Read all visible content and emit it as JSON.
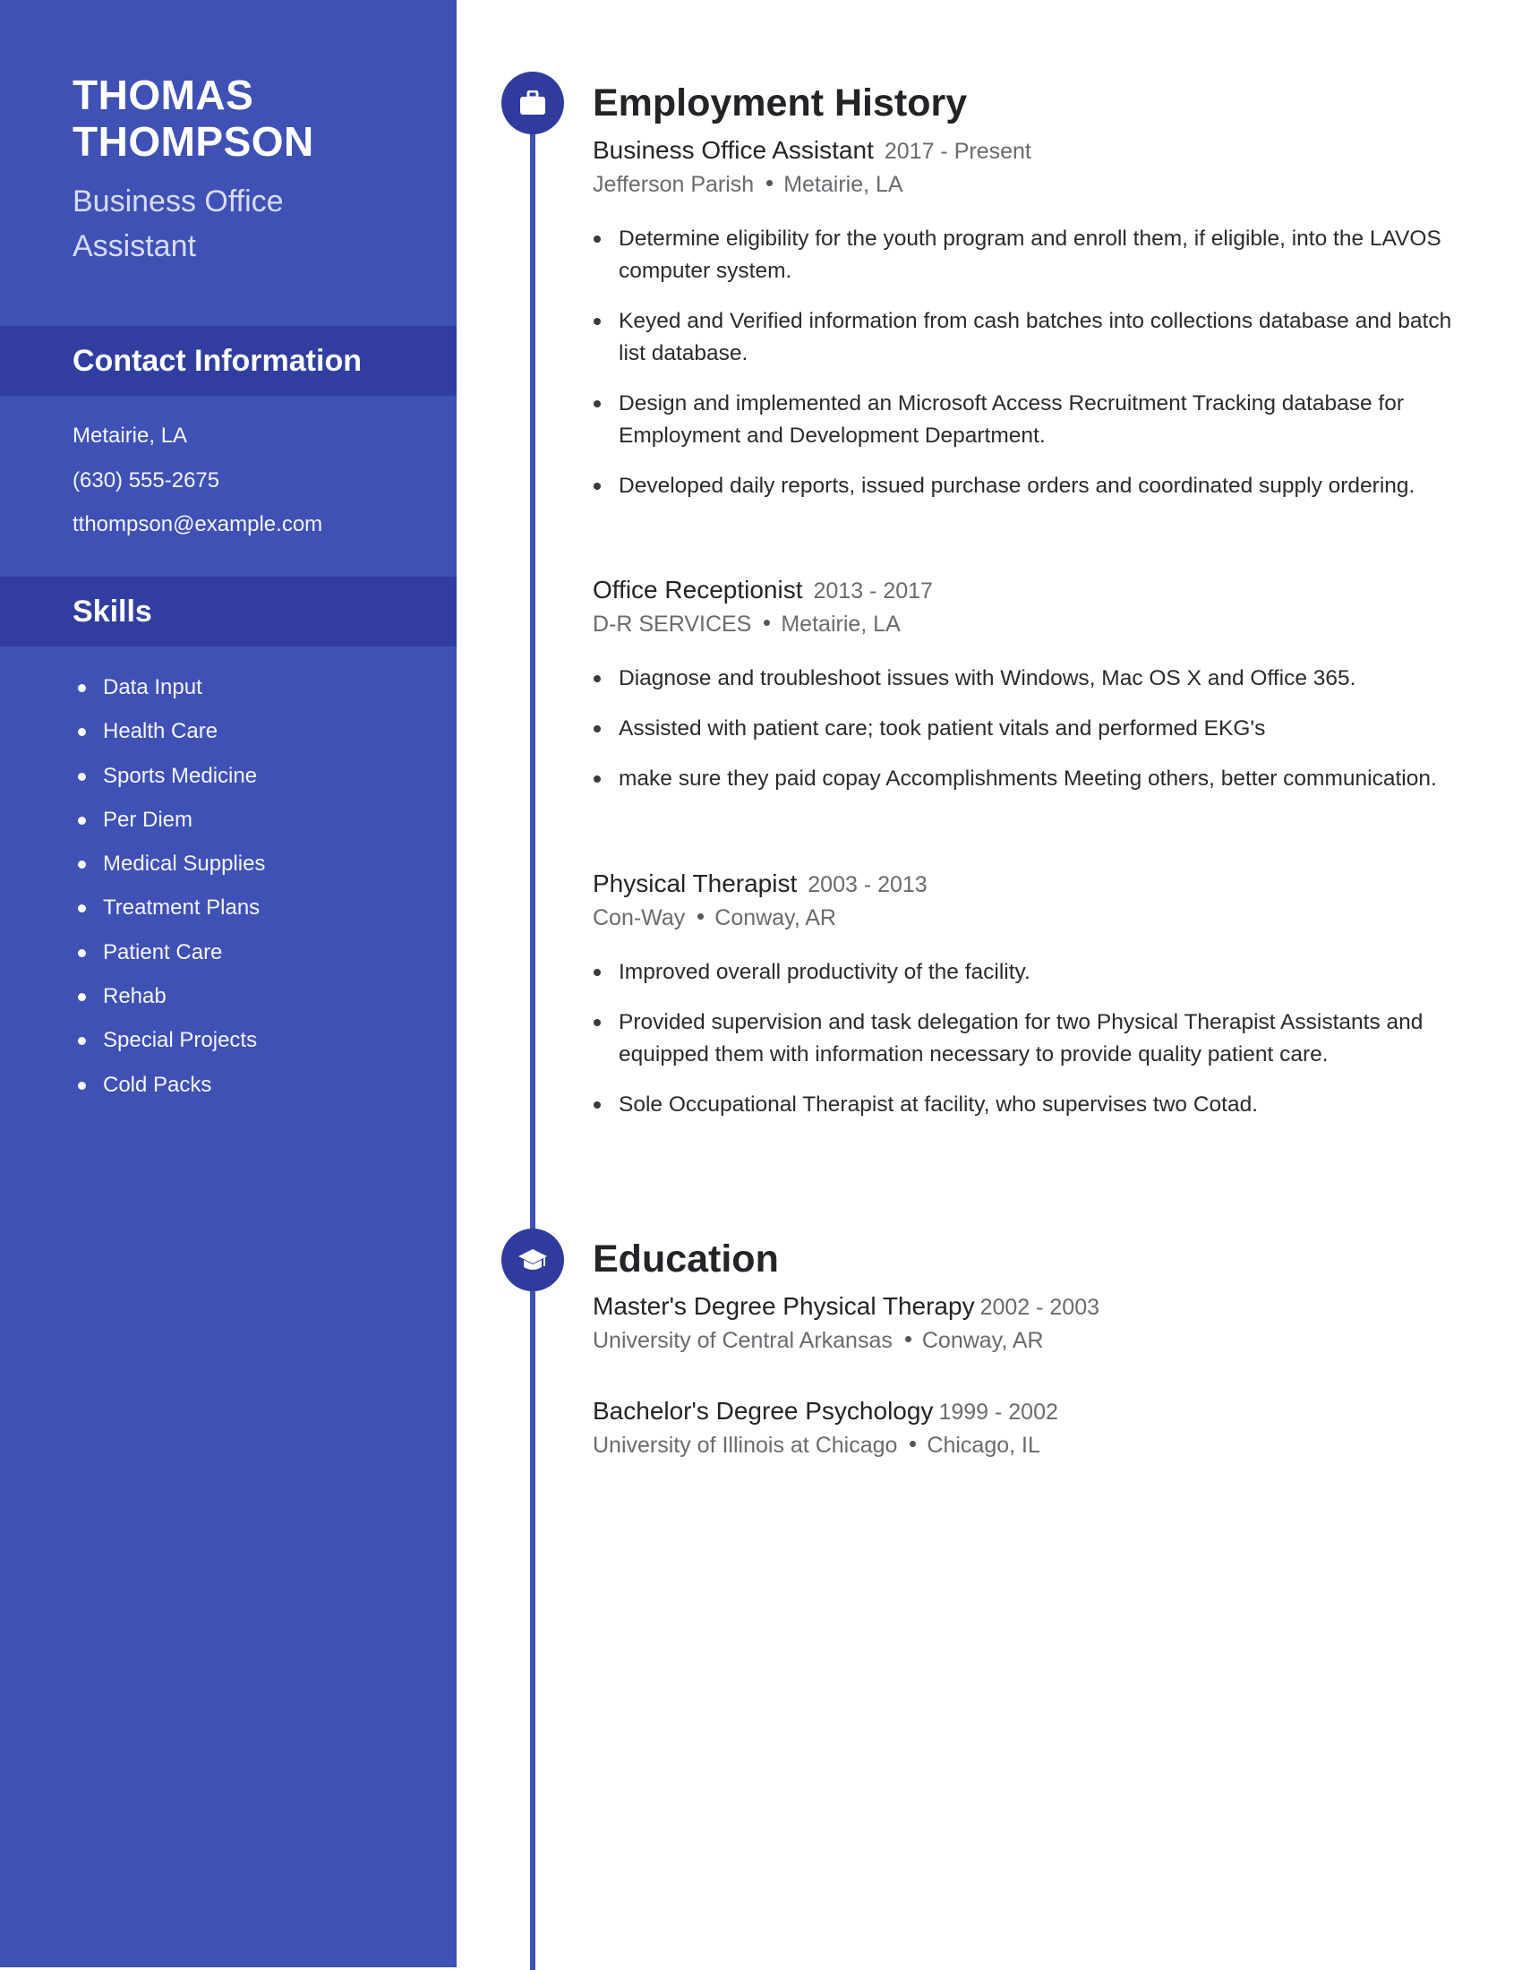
{
  "colors": {
    "sidebar": "#3f51b5",
    "sidebar_band": "#303f9f",
    "timeline": "#3f51b5",
    "icon_circle": "#2f3c9e"
  },
  "sidebar": {
    "name_line1": "THOMAS",
    "name_line2": "THOMPSON",
    "title_line1": "Business Office",
    "title_line2": "Assistant",
    "contact_heading": "Contact Information",
    "contact": [
      "Metairie, LA",
      "(630) 555-2675",
      "tthompson@example.com"
    ],
    "skills_heading": "Skills",
    "skills": [
      "Data Input",
      "Health Care",
      "Sports Medicine",
      "Per Diem",
      "Medical Supplies",
      "Treatment Plans",
      "Patient Care",
      "Rehab",
      "Special Projects",
      "Cold Packs"
    ]
  },
  "employment": {
    "icon": "briefcase-icon",
    "heading": "Employment History",
    "jobs": [
      {
        "role": "Business Office Assistant",
        "dates": "2017 - Present",
        "company": "Jefferson Parish",
        "location": "Metairie, LA",
        "bullets": [
          "Determine eligibility for the youth program and enroll them, if eligible, into the LAVOS computer system.",
          "Keyed and Verified information from cash batches into collections database and batch list database.",
          "Design and implemented an Microsoft Access Recruitment Tracking database for Employment and Development Department.",
          "Developed daily reports, issued purchase orders and coordinated supply ordering."
        ]
      },
      {
        "role": "Office Receptionist",
        "dates": "2013 - 2017",
        "company": "D-R SERVICES",
        "location": "Metairie, LA",
        "bullets": [
          "Diagnose and troubleshoot issues with Windows, Mac OS X and Office 365.",
          "Assisted with patient care; took patient vitals and performed EKG's",
          "make sure they paid copay Accomplishments Meeting others, better communication."
        ]
      },
      {
        "role": "Physical Therapist",
        "dates": "2003 - 2013",
        "company": "Con-Way",
        "location": "Conway, AR",
        "bullets": [
          "Improved overall productivity of the facility.",
          "Provided supervision and task delegation for two Physical Therapist Assistants and equipped them with information necessary to provide quality patient care.",
          "Sole Occupational Therapist at facility, who supervises two Cotad."
        ]
      }
    ]
  },
  "education": {
    "icon": "graduation-cap-icon",
    "heading": "Education",
    "items": [
      {
        "degree": "Master's Degree Physical Therapy",
        "dates": "2002 - 2003",
        "school": "University of Central Arkansas",
        "location": "Conway, AR"
      },
      {
        "degree": "Bachelor's Degree Psychology",
        "dates": "1999 - 2002",
        "school": "University of Illinois at Chicago",
        "location": "Chicago, IL"
      }
    ]
  }
}
